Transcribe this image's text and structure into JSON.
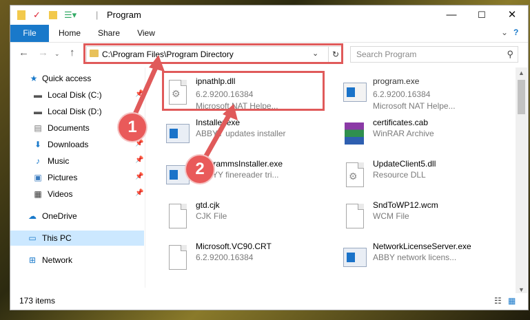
{
  "window": {
    "title": "Program",
    "controls": [
      "—",
      "☐",
      "✕"
    ]
  },
  "ribbon": {
    "file": "File",
    "tabs": [
      "Home",
      "Share",
      "View"
    ]
  },
  "address": {
    "path": "C:\\Program Files\\Program Directory",
    "refresh": "↻"
  },
  "search": {
    "placeholder": "Search Program"
  },
  "sidebar": {
    "items": [
      {
        "label": "Quick access",
        "icon": "star-icon"
      },
      {
        "label": "Local Disk (C:)",
        "icon": "drive-icon"
      },
      {
        "label": "Local Disk (D:)",
        "icon": "drive-icon"
      },
      {
        "label": "Documents",
        "icon": "documents-icon"
      },
      {
        "label": "Downloads",
        "icon": "downloads-icon"
      },
      {
        "label": "Music",
        "icon": "music-icon"
      },
      {
        "label": "Pictures",
        "icon": "pictures-icon"
      },
      {
        "label": "Videos",
        "icon": "videos-icon"
      },
      {
        "label": "OneDrive",
        "icon": "cloud-icon"
      },
      {
        "label": "This PC",
        "icon": "computer-icon"
      },
      {
        "label": "Network",
        "icon": "network-icon"
      }
    ]
  },
  "files": {
    "left": [
      {
        "name": "ipnathlp.dll",
        "line2": "6.2.9200.16384",
        "line3": "Microsoft NAT Helpe...",
        "icon": "dll-icon"
      },
      {
        "name": "Installer.exe",
        "line2": "ABBYY updates installer",
        "line3": "",
        "icon": "installer-icon"
      },
      {
        "name": "ProgrammsInstaller.exe",
        "line2": "ABBYY finereader tri...",
        "line3": "",
        "icon": "installer-icon"
      },
      {
        "name": "gtd.cjk",
        "line2": "CJK File",
        "line3": "",
        "icon": "file-icon"
      },
      {
        "name": "Microsoft.VC90.CRT",
        "line2": "6.2.9200.16384",
        "line3": "",
        "icon": "file-icon"
      }
    ],
    "right": [
      {
        "name": "program.exe",
        "line2": "6.2.9200.16384",
        "line3": "Microsoft NAT Helpe...",
        "icon": "exe-icon"
      },
      {
        "name": "certificates.cab",
        "line2": "WinRAR Archive",
        "line3": "",
        "icon": "winrar-icon"
      },
      {
        "name": "UpdateClient5.dll",
        "line2": "Resource DLL",
        "line3": "",
        "icon": "dll-icon"
      },
      {
        "name": "SndToWP12.wcm",
        "line2": "WCM File",
        "line3": "",
        "icon": "file-icon"
      },
      {
        "name": "NetworkLicenseServer.exe",
        "line2": "ABBY network licens...",
        "line3": "",
        "icon": "installer-icon"
      }
    ]
  },
  "status": {
    "count": "173 items"
  },
  "annotations": {
    "badge1": "1",
    "badge2": "2",
    "color": "#e05a5a"
  }
}
